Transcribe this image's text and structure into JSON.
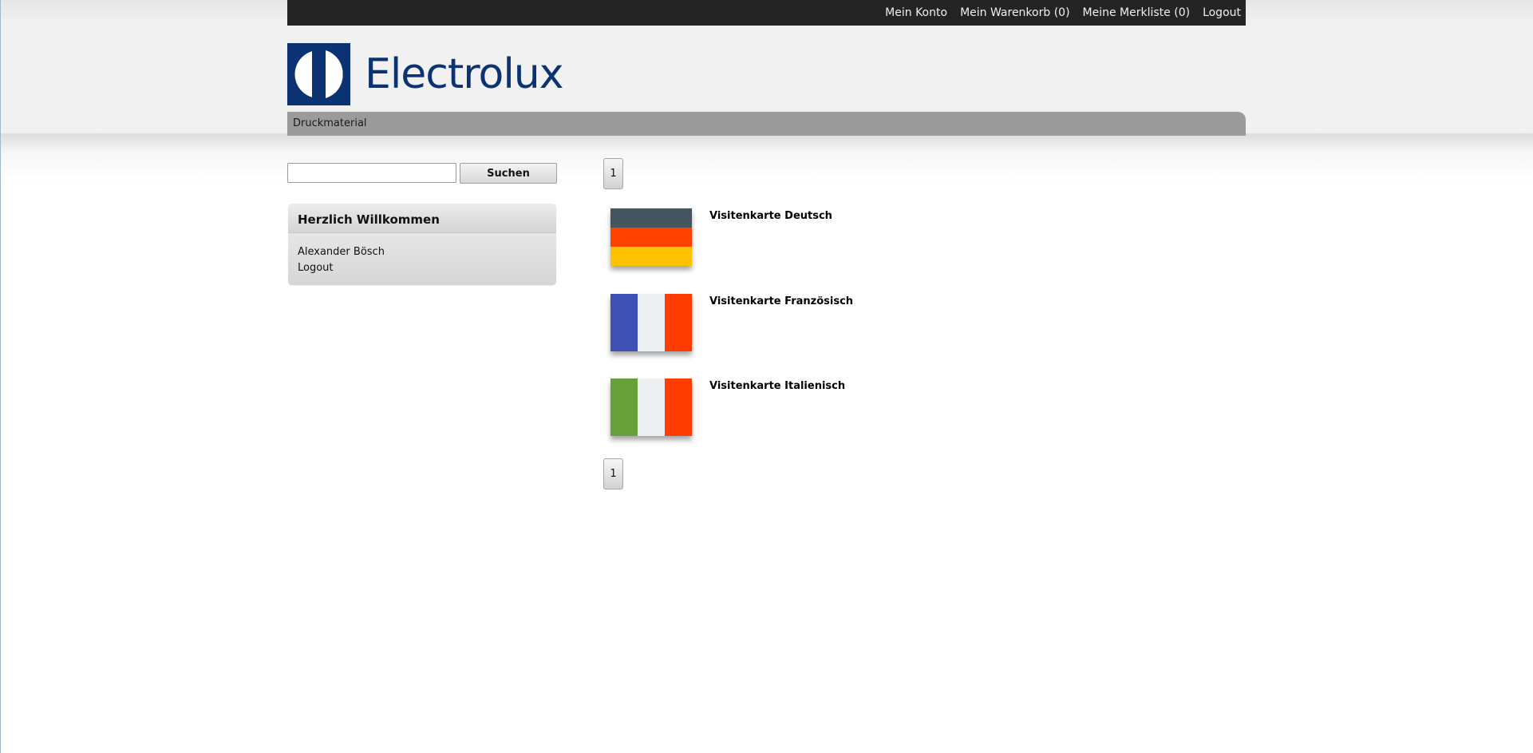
{
  "topbar": {
    "links": [
      "Mein Konto",
      "Mein Warenkorb (0)",
      "Meine Merkliste (0)",
      "Logout"
    ]
  },
  "brand": {
    "name": "Electrolux",
    "color": "#0b3373"
  },
  "nav": {
    "items": [
      "Druckmaterial"
    ]
  },
  "search": {
    "value": "",
    "button_label": "Suchen"
  },
  "welcome": {
    "title": "Herzlich Willkommen",
    "user_name": "Alexander Bösch",
    "logout_label": "Logout"
  },
  "pagination": {
    "current_page": "1"
  },
  "products": [
    {
      "title": "Visitenkarte Deutsch",
      "flag_icon": "germany-flag-icon",
      "colors": [
        "#455560",
        "#fe4200",
        "#fec200"
      ]
    },
    {
      "title": "Visitenkarte Französisch",
      "flag_icon": "france-flag-icon",
      "colors": [
        "#3f51b5",
        "#eceff1",
        "#ff3d00"
      ]
    },
    {
      "title": "Visitenkarte Italienisch",
      "flag_icon": "italy-flag-icon",
      "colors": [
        "#689f38",
        "#eceff1",
        "#ff3d00"
      ]
    }
  ]
}
